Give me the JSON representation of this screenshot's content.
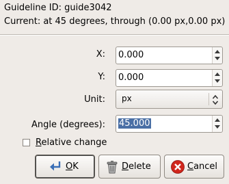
{
  "info": {
    "guideline_id": "Guideline ID: guide3042",
    "current": "Current: at 45 degrees, through (0.00 px,0.00 px)"
  },
  "fields": {
    "x": {
      "label": "X:",
      "value": "0.000"
    },
    "y": {
      "label": "Y:",
      "value": "0.000"
    },
    "unit": {
      "label": "Unit:",
      "value": "px"
    },
    "angle": {
      "label": "Angle (degrees):",
      "value": "45.000"
    }
  },
  "relative_change": {
    "label_rest": "elative change",
    "mnemonic": "R",
    "checked": false
  },
  "buttons": {
    "ok": {
      "mnemonic": "O",
      "rest": "K",
      "icon": "ok-arrow-icon"
    },
    "delete": {
      "mnemonic": "D",
      "rest": "elete",
      "icon": "trash-icon"
    },
    "cancel": {
      "mnemonic": "C",
      "rest": "ancel",
      "icon": "cancel-icon"
    }
  },
  "colors": {
    "background": "#efebe7",
    "selection": "#4a6fa5",
    "cancel_icon": "#d0261c",
    "ok_icon": "#3b6fb6"
  }
}
